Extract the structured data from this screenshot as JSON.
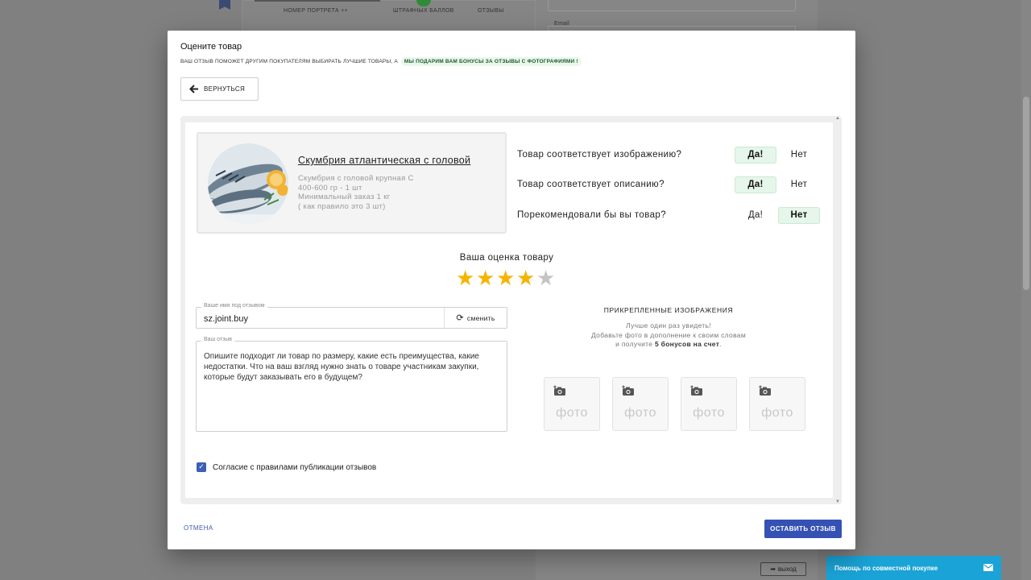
{
  "background": {
    "tab_portrait_label": "НОМЕР ПОРТРЕТА ++",
    "tab_points_label": "ШТРАФНЫХ БАЛЛОВ",
    "tab_reviews_label": "ОТЗЫВЫ",
    "email_label": "Email",
    "exit_label": "выход",
    "help_label": "Помощь по совместной покупке"
  },
  "modal": {
    "title": "Оцените товар",
    "subtitle": "ВАШ ОТЗЫВ ПОМОЖЕТ ДРУГИМ ПОКУПАТЕЛЯМ ВЫБИРАТЬ ЛУЧШИЕ ТОВАРЫ, А",
    "subtitle_badge": "МЫ ПОДАРИМ ВАМ БОНУСЫ ЗА ОТЗЫВЫ С ФОТОГРАФИЯМИ !",
    "back_label": "ВЕРНУТЬСЯ",
    "cancel_label": "ОТМЕНА",
    "submit_label": "ОСТАВИТЬ ОТЗЫВ"
  },
  "product": {
    "name": "Скумбрия атлантическая с головой",
    "desc_lines": [
      "Скумбрия с головой крупная С",
      "400-600 гр - 1 шт",
      "Минимальный заказ 1 кг",
      "( как правило это 3 шт)"
    ]
  },
  "questions": [
    {
      "text": "Товар соответствует изображению?",
      "yes": "Да!",
      "no": "Нет",
      "selected": "yes"
    },
    {
      "text": "Товар соответствует описанию?",
      "yes": "Да!",
      "no": "Нет",
      "selected": "yes"
    },
    {
      "text": "Порекомендовали бы вы товар?",
      "yes": "Да!",
      "no": "Нет",
      "selected": "no"
    }
  ],
  "rating": {
    "title": "Ваша оценка товару",
    "value": 4,
    "max": 5
  },
  "name_field": {
    "label": "Ваше имя под отзывом",
    "value": "sz.joint.buy",
    "change_label": "сменить"
  },
  "review_field": {
    "label": "Ваш отзыв",
    "placeholder": "Опишите подходит ли товар по размеру, какие есть преимущества, какие недостатки. Что на ваш взгляд нужно знать о товаре участникам закупки, которые будут заказывать его в будущем?"
  },
  "consent": {
    "label": "Согласие с правилами публикации отзывов",
    "checked": true
  },
  "attachments": {
    "title": "ПРИКРЕПЛЕННЫЕ ИЗОБРАЖЕНИЯ",
    "line1": "Лучше один раз увидеть!",
    "line2": "Добавьте фото в дополнение к своим словам",
    "line3_pre": "и получите ",
    "line3_bold": "5 бонусов на счет",
    "line3_post": ".",
    "slot_label": "фото",
    "slots": [
      "фото",
      "фото",
      "фото",
      "фото"
    ]
  },
  "colors": {
    "primary": "#3551b4",
    "star_on": "#f6b400",
    "star_off": "#c4c4c4",
    "selected_option_bg": "#e6f6ea",
    "help_bar": "#1aa3d6"
  }
}
